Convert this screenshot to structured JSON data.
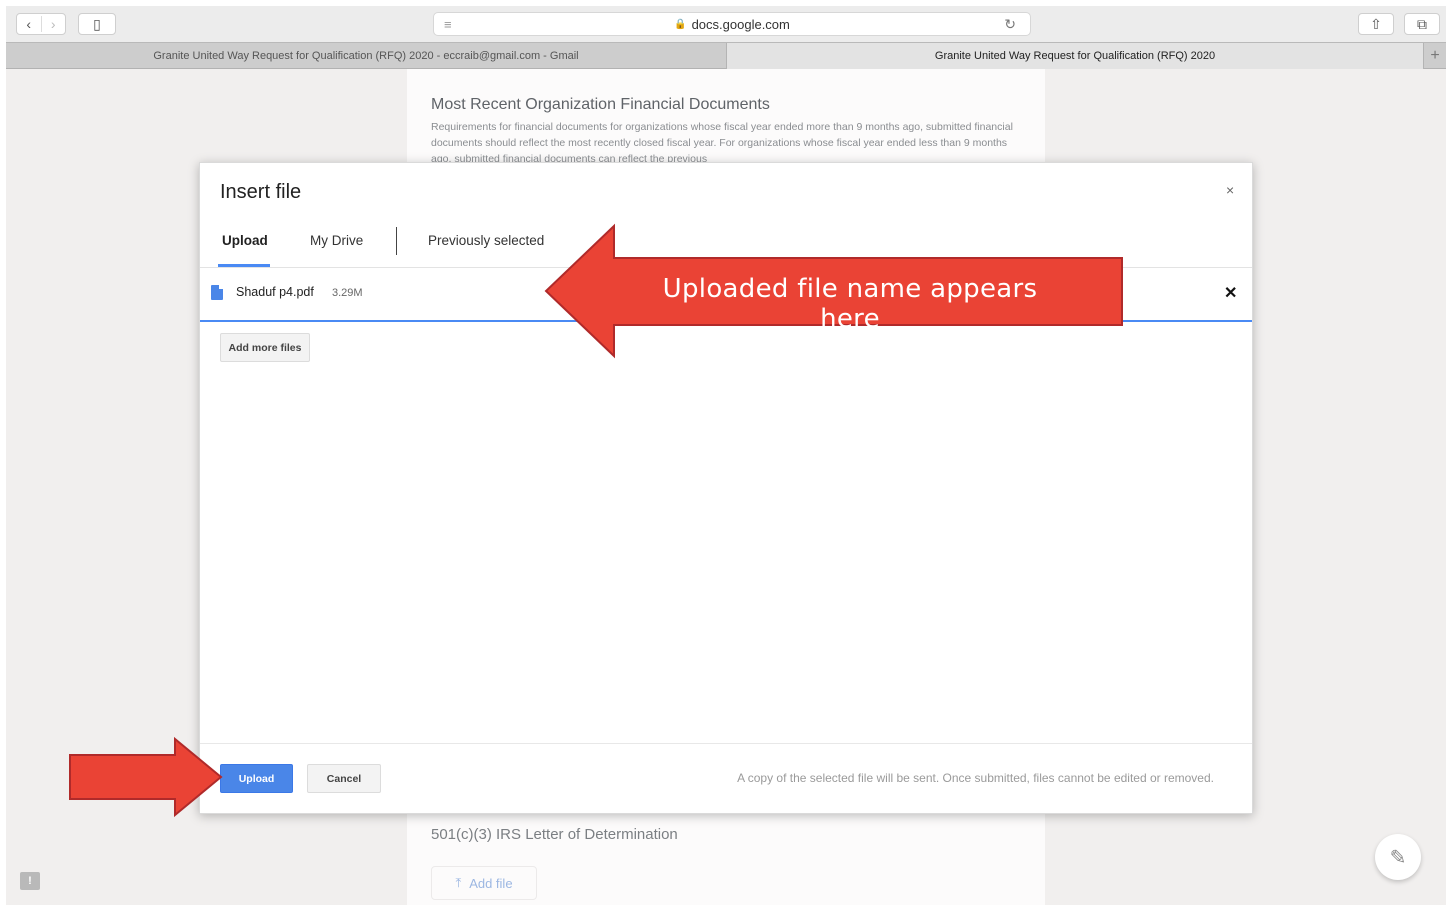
{
  "browser": {
    "url": "docs.google.com",
    "tabs": [
      {
        "label": "Granite United Way Request for Qualification (RFQ) 2020 - eccraib@gmail.com - Gmail"
      },
      {
        "label": "Granite United Way Request for Qualification (RFQ) 2020"
      }
    ],
    "icons": {
      "back": "‹",
      "forward": "›",
      "sidebar": "▯",
      "reader": "≡",
      "lock": "🔒",
      "reload": "↻",
      "share": "⇧",
      "tabs_overview": "⧉",
      "new_tab": "+"
    }
  },
  "form": {
    "section_title": "Most Recent Organization Financial Documents",
    "section_description": "Requirements for financial documents for organizations whose fiscal year ended more than 9 months ago, submitted financial documents should reflect the most recently closed fiscal year. For organizations whose fiscal year ended less than 9 months ago, submitted financial documents can reflect the previous",
    "section2_title": "501(c)(3) IRS Letter of Determination",
    "add_file_label": "Add file",
    "add_file_icon": "⤒",
    "feedback_icon": "!",
    "edit_icon": "✎"
  },
  "dialog": {
    "title": "Insert file",
    "close_icon": "×",
    "tabs": [
      {
        "label": "Upload",
        "active": true
      },
      {
        "label": "My Drive"
      },
      {
        "label": "Previously selected"
      }
    ],
    "file": {
      "name": "Shaduf p4.pdf",
      "size": "3.29M",
      "remove_icon": "✕"
    },
    "add_more_label": "Add more files",
    "upload_label": "Upload",
    "cancel_label": "Cancel",
    "footer_note": "A copy of the selected file will be sent. Once submitted, files cannot be edited or removed."
  },
  "annotation": {
    "callout_text": "Uploaded file name appears here",
    "arrow_color": "#ea4335"
  }
}
